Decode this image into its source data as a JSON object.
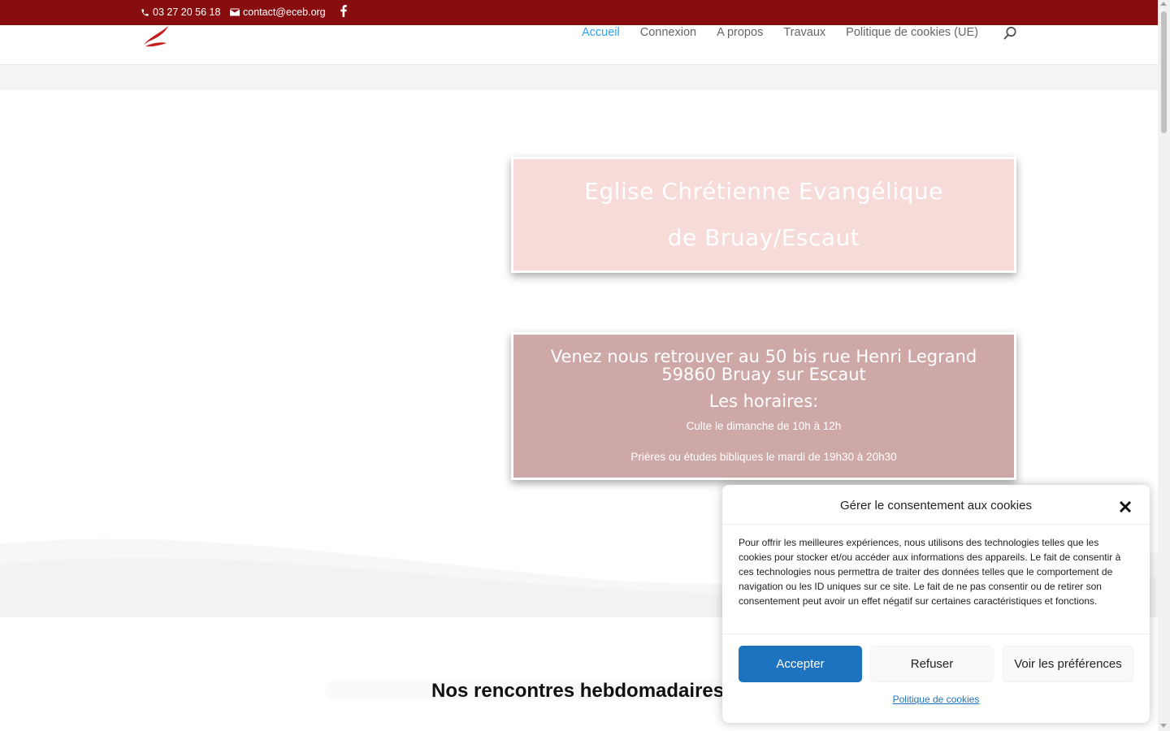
{
  "topbar": {
    "phone": "03 27 20 56 18",
    "email": "contact@eceb.org",
    "social_icon": "facebook-icon"
  },
  "nav": {
    "items": [
      {
        "label": "Accueil"
      },
      {
        "label": "Connexion"
      },
      {
        "label": "A propos"
      },
      {
        "label": "Travaux"
      },
      {
        "label": "Politique de cookies (UE)"
      }
    ],
    "active_color": "#2ea3f2"
  },
  "hero": {
    "title_line1": "Eglise Chrétienne Evangélique",
    "title_line2": "de Bruay/Escaut",
    "address_line1": "Venez nous retrouver au 50 bis rue Henri Legrand",
    "address_line2": "59860 Bruay sur Escaut",
    "hours_title": "Les horaires:",
    "hours_1": "Culte le dimanche de 10h à 12h",
    "hours_2": "Prières ou études bibliques le mardi de 19h30 à 20h30"
  },
  "section": {
    "title": "Nos rencontres hebdomadaires"
  },
  "cookie": {
    "title": "Gérer le consentement aux cookies",
    "message": "Pour offrir les meilleures expériences, nous utilisons des technologies telles que les cookies pour stocker et/ou accéder aux informations des appareils. Le fait de consentir à ces technologies nous permettra de traiter des données telles que le comportement de navigation ou les ID uniques sur ce site. Le fait de ne pas consentir ou de retirer son consentement peut avoir un effet négatif sur certaines caractéristiques et fonctions.",
    "accept_label": "Accepter",
    "deny_label": "Refuser",
    "prefs_label": "Voir les préférences",
    "policy_label": "Politique de cookies"
  },
  "colors": {
    "topbar": "#880d0f",
    "card1": "#f6dbd9",
    "card2": "#cda8a6",
    "accept": "#1e73be"
  }
}
